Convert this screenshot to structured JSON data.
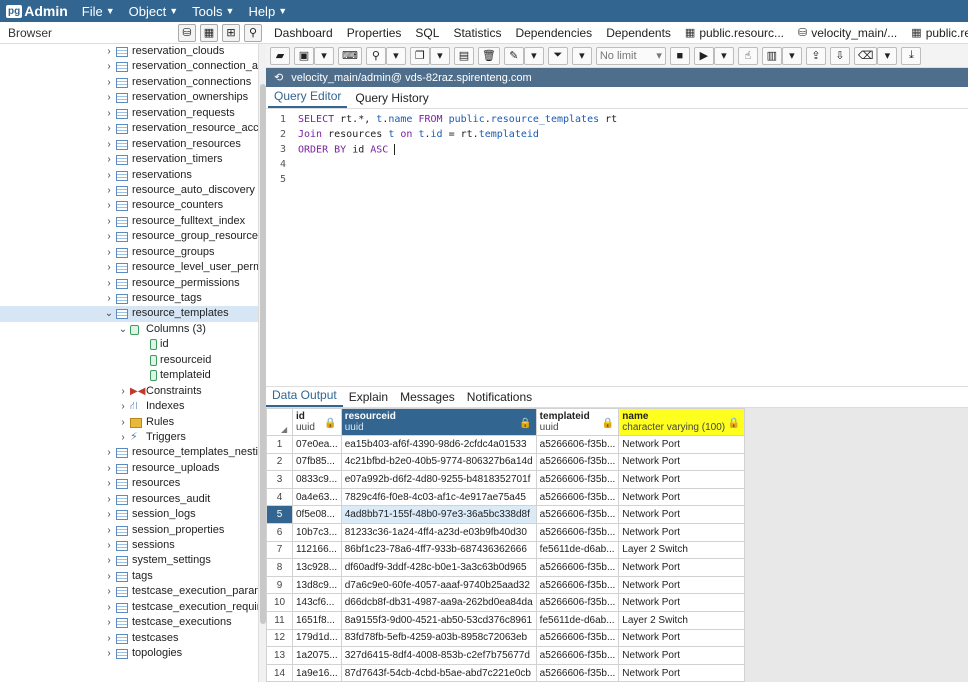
{
  "app": {
    "logo_pg": "pg",
    "logo_text": "Admin"
  },
  "menu": [
    {
      "label": "File"
    },
    {
      "label": "Object"
    },
    {
      "label": "Tools"
    },
    {
      "label": "Help"
    }
  ],
  "browser": {
    "title": "Browser"
  },
  "tree": [
    {
      "label": "reservation_clouds",
      "level": 0,
      "type": "table",
      "chev": ">"
    },
    {
      "label": "reservation_connection_argume",
      "level": 0,
      "type": "table",
      "chev": ">"
    },
    {
      "label": "reservation_connections",
      "level": 0,
      "type": "table",
      "chev": ">"
    },
    {
      "label": "reservation_ownerships",
      "level": 0,
      "type": "table",
      "chev": ">"
    },
    {
      "label": "reservation_requests",
      "level": 0,
      "type": "table",
      "chev": ">"
    },
    {
      "label": "reservation_resource_access_le",
      "level": 0,
      "type": "table",
      "chev": ">"
    },
    {
      "label": "reservation_resources",
      "level": 0,
      "type": "table",
      "chev": ">"
    },
    {
      "label": "reservation_timers",
      "level": 0,
      "type": "table",
      "chev": ">"
    },
    {
      "label": "reservations",
      "level": 0,
      "type": "table",
      "chev": ">"
    },
    {
      "label": "resource_auto_discovery",
      "level": 0,
      "type": "table",
      "chev": ">"
    },
    {
      "label": "resource_counters",
      "level": 0,
      "type": "table",
      "chev": ">"
    },
    {
      "label": "resource_fulltext_index",
      "level": 0,
      "type": "table",
      "chev": ">"
    },
    {
      "label": "resource_group_resources",
      "level": 0,
      "type": "table",
      "chev": ">"
    },
    {
      "label": "resource_groups",
      "level": 0,
      "type": "table",
      "chev": ">"
    },
    {
      "label": "resource_level_user_permissio",
      "level": 0,
      "type": "table",
      "chev": ">"
    },
    {
      "label": "resource_permissions",
      "level": 0,
      "type": "table",
      "chev": ">"
    },
    {
      "label": "resource_tags",
      "level": 0,
      "type": "table",
      "chev": ">"
    },
    {
      "label": "resource_templates",
      "level": 0,
      "type": "table",
      "chev": "v",
      "selected": true
    },
    {
      "label": "Columns (3)",
      "level": 1,
      "type": "cols",
      "chev": "v"
    },
    {
      "label": "id",
      "level": 2,
      "type": "col",
      "chev": ""
    },
    {
      "label": "resourceid",
      "level": 2,
      "type": "col",
      "chev": ""
    },
    {
      "label": "templateid",
      "level": 2,
      "type": "col",
      "chev": ""
    },
    {
      "label": "Constraints",
      "level": 1,
      "type": "constr",
      "chev": ">"
    },
    {
      "label": "Indexes",
      "level": 1,
      "type": "idx",
      "chev": ">"
    },
    {
      "label": "Rules",
      "level": 1,
      "type": "rules",
      "chev": ">"
    },
    {
      "label": "Triggers",
      "level": 1,
      "type": "trig",
      "chev": ">"
    },
    {
      "label": "resource_templates_nesting",
      "level": 0,
      "type": "table",
      "chev": ">"
    },
    {
      "label": "resource_uploads",
      "level": 0,
      "type": "table",
      "chev": ">"
    },
    {
      "label": "resources",
      "level": 0,
      "type": "table",
      "chev": ">"
    },
    {
      "label": "resources_audit",
      "level": 0,
      "type": "table",
      "chev": ">"
    },
    {
      "label": "session_logs",
      "level": 0,
      "type": "table",
      "chev": ">"
    },
    {
      "label": "session_properties",
      "level": 0,
      "type": "table",
      "chev": ">"
    },
    {
      "label": "sessions",
      "level": 0,
      "type": "table",
      "chev": ">"
    },
    {
      "label": "system_settings",
      "level": 0,
      "type": "table",
      "chev": ">"
    },
    {
      "label": "tags",
      "level": 0,
      "type": "table",
      "chev": ">"
    },
    {
      "label": "testcase_execution_parameters",
      "level": 0,
      "type": "table",
      "chev": ">"
    },
    {
      "label": "testcase_execution_requiremer",
      "level": 0,
      "type": "table",
      "chev": ">"
    },
    {
      "label": "testcase_executions",
      "level": 0,
      "type": "table",
      "chev": ">"
    },
    {
      "label": "testcases",
      "level": 0,
      "type": "table",
      "chev": ">"
    },
    {
      "label": "topologies",
      "level": 0,
      "type": "table",
      "chev": ">"
    }
  ],
  "tabs": [
    {
      "label": "Dashboard",
      "icon": ""
    },
    {
      "label": "Properties",
      "icon": ""
    },
    {
      "label": "SQL",
      "icon": ""
    },
    {
      "label": "Statistics",
      "icon": ""
    },
    {
      "label": "Dependencies",
      "icon": ""
    },
    {
      "label": "Dependents",
      "icon": ""
    },
    {
      "label": "public.resourc...",
      "icon": "▦"
    },
    {
      "label": "velocity_main/...",
      "icon": "⛁"
    },
    {
      "label": "public.resourc...",
      "icon": "▦"
    },
    {
      "label": "public",
      "icon": "▦"
    }
  ],
  "toolbar": {
    "limit_label": "No limit"
  },
  "connection": {
    "label": "velocity_main/admin@ vds-82raz.spirenteng.com"
  },
  "editor_tabs": [
    {
      "label": "Query Editor"
    },
    {
      "label": "Query History"
    }
  ],
  "editor": {
    "line_numbers": [
      "1",
      "2",
      "3",
      "4",
      "5"
    ],
    "line1": [
      {
        "t": "SELECT",
        "c": "kw"
      },
      {
        "t": " rt.*, ",
        "c": ""
      },
      {
        "t": "t",
        "c": "nm"
      },
      {
        "t": ".",
        "c": ""
      },
      {
        "t": "name",
        "c": "nm"
      },
      {
        "t": " ",
        "c": ""
      },
      {
        "t": "FROM",
        "c": "kw"
      },
      {
        "t": " ",
        "c": ""
      },
      {
        "t": "public",
        "c": "nm"
      },
      {
        "t": ".",
        "c": ""
      },
      {
        "t": "resource_templates",
        "c": "nm"
      },
      {
        "t": " rt",
        "c": ""
      }
    ],
    "line2": [
      {
        "t": "Join",
        "c": "kw"
      },
      {
        "t": " resources ",
        "c": ""
      },
      {
        "t": "t",
        "c": "nm"
      },
      {
        "t": " ",
        "c": ""
      },
      {
        "t": "on",
        "c": "kw"
      },
      {
        "t": " ",
        "c": ""
      },
      {
        "t": "t",
        "c": "nm"
      },
      {
        "t": ".",
        "c": ""
      },
      {
        "t": "id",
        "c": "nm"
      },
      {
        "t": " = rt.",
        "c": ""
      },
      {
        "t": "templateid",
        "c": "nm"
      }
    ],
    "line3": [
      {
        "t": "ORDER BY",
        "c": "kw"
      },
      {
        "t": " id ",
        "c": ""
      },
      {
        "t": "ASC",
        "c": "kw"
      },
      {
        "t": " ",
        "c": ""
      }
    ]
  },
  "output_tabs": [
    {
      "label": "Data Output"
    },
    {
      "label": "Explain"
    },
    {
      "label": "Messages"
    },
    {
      "label": "Notifications"
    }
  ],
  "grid": {
    "columns": [
      {
        "name": "id",
        "type": "uuid"
      },
      {
        "name": "resourceid",
        "type": "uuid"
      },
      {
        "name": "templateid",
        "type": "uuid"
      },
      {
        "name": "name",
        "type": "character varying (100)"
      }
    ],
    "rows": [
      {
        "n": "1",
        "id": "07e0ea...",
        "resourceid": "ea15b403-af6f-4390-98d6-2cfdc4a01533",
        "templateid": "a5266606-f35b...",
        "name": "Network Port"
      },
      {
        "n": "2",
        "id": "07fb85...",
        "resourceid": "4c21bfbd-b2e0-40b5-9774-806327b6a14d",
        "templateid": "a5266606-f35b...",
        "name": "Network Port"
      },
      {
        "n": "3",
        "id": "0833c9...",
        "resourceid": "e07a992b-d6f2-4d80-9255-b4818352701f",
        "templateid": "a5266606-f35b...",
        "name": "Network Port"
      },
      {
        "n": "4",
        "id": "0a4e63...",
        "resourceid": "7829c4f6-f0e8-4c03-af1c-4e917ae75a45",
        "templateid": "a5266606-f35b...",
        "name": "Network Port"
      },
      {
        "n": "5",
        "id": "0f5e08...",
        "resourceid": "4ad8bb71-155f-48b0-97e3-36a5bc338d8f",
        "templateid": "a5266606-f35b...",
        "name": "Network Port",
        "selected": true
      },
      {
        "n": "6",
        "id": "10b7c3...",
        "resourceid": "81233c36-1a24-4ff4-a23d-e03b9fb40d30",
        "templateid": "a5266606-f35b...",
        "name": "Network Port"
      },
      {
        "n": "7",
        "id": "112166...",
        "resourceid": "86bf1c23-78a6-4ff7-933b-687436362666",
        "templateid": "fe5611de-d6ab...",
        "name": "Layer 2 Switch"
      },
      {
        "n": "8",
        "id": "13c928...",
        "resourceid": "df60adf9-3ddf-428c-b0e1-3a3c63b0d965",
        "templateid": "a5266606-f35b...",
        "name": "Network Port"
      },
      {
        "n": "9",
        "id": "13d8c9...",
        "resourceid": "d7a6c9e0-60fe-4057-aaaf-9740b25aad32",
        "templateid": "a5266606-f35b...",
        "name": "Network Port"
      },
      {
        "n": "10",
        "id": "143cf6...",
        "resourceid": "d66dcb8f-db31-4987-aa9a-262bd0ea84da",
        "templateid": "a5266606-f35b...",
        "name": "Network Port"
      },
      {
        "n": "11",
        "id": "1651f8...",
        "resourceid": "8a9155f3-9d00-4521-ab50-53cd376c8961",
        "templateid": "fe5611de-d6ab...",
        "name": "Layer 2 Switch"
      },
      {
        "n": "12",
        "id": "179d1d...",
        "resourceid": "83fd78fb-5efb-4259-a03b-8958c72063eb",
        "templateid": "a5266606-f35b...",
        "name": "Network Port"
      },
      {
        "n": "13",
        "id": "1a2075...",
        "resourceid": "327d6415-8df4-4008-853b-c2ef7b75677d",
        "templateid": "a5266606-f35b...",
        "name": "Network Port"
      },
      {
        "n": "14",
        "id": "1a9e16...",
        "resourceid": "87d7643f-54cb-4cbd-b5ae-abd7c221e0cb",
        "templateid": "a5266606-f35b...",
        "name": "Network Port"
      }
    ]
  },
  "colors": {
    "brand": "#326690",
    "highlight": "#ffff1f"
  }
}
